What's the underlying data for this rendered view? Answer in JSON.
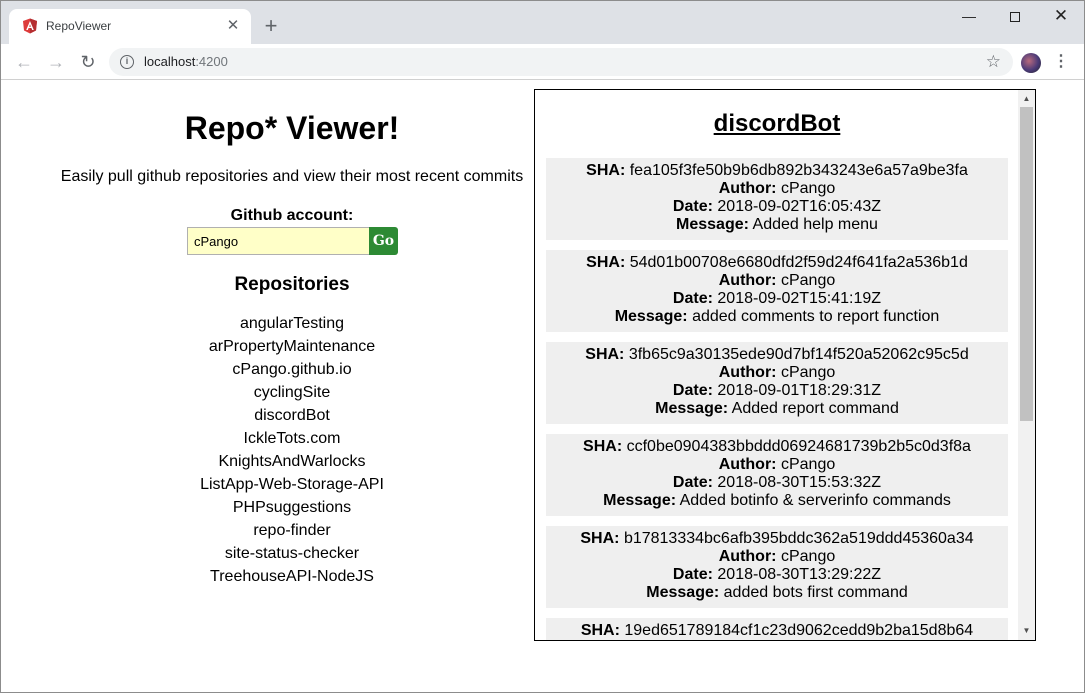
{
  "browser": {
    "tab_title": "RepoViewer",
    "url_host": "localhost",
    "url_port": ":4200",
    "icons": {
      "favicon": "angular-icon",
      "close": "close-icon",
      "new_tab": "plus-icon",
      "back": "back-arrow-icon",
      "forward": "forward-arrow-icon",
      "reload": "reload-icon",
      "info": "info-icon",
      "bookmark": "star-icon",
      "menu": "kebab-menu-icon"
    }
  },
  "app": {
    "title": "Repo* Viewer!",
    "tagline": "Easily pull github repositories and view their most recent commits",
    "account_label": "Github account:",
    "account_value": "cPango",
    "go_label": "Go",
    "repos_heading": "Repositories",
    "repos": [
      "angularTesting",
      "arPropertyMaintenance",
      "cPango.github.io",
      "cyclingSite",
      "discordBot",
      "IckleTots.com",
      "KnightsAndWarlocks",
      "ListApp-Web-Storage-API",
      "PHPsuggestions",
      "repo-finder",
      "site-status-checker",
      "TreehouseAPI-NodeJS"
    ]
  },
  "commits_panel": {
    "repo_name": "discordBot",
    "labels": {
      "sha": "SHA:",
      "author": "Author:",
      "date": "Date:",
      "message": "Message:"
    },
    "commits": [
      {
        "sha": "fea105f3fe50b9b6db892b343243e6a57a9be3fa",
        "author": "cPango",
        "date": "2018-09-02T16:05:43Z",
        "message": "Added help menu"
      },
      {
        "sha": "54d01b00708e6680dfd2f59d24f641fa2a536b1d",
        "author": "cPango",
        "date": "2018-09-02T15:41:19Z",
        "message": "added comments to report function"
      },
      {
        "sha": "3fb65c9a30135ede90d7bf14f520a52062c95c5d",
        "author": "cPango",
        "date": "2018-09-01T18:29:31Z",
        "message": "Added report command"
      },
      {
        "sha": "ccf0be0904383bbddd06924681739b2b5c0d3f8a",
        "author": "cPango",
        "date": "2018-08-30T15:53:32Z",
        "message": "Added botinfo & serverinfo commands"
      },
      {
        "sha": "b17813334bc6afb395bddc362a519ddd45360a34",
        "author": "cPango",
        "date": "2018-08-30T13:29:22Z",
        "message": "added bots first command"
      },
      {
        "sha": "19ed651789184cf1c23d9062cedd9b2ba15d8b64",
        "author": "",
        "date": "",
        "message": ""
      }
    ]
  }
}
